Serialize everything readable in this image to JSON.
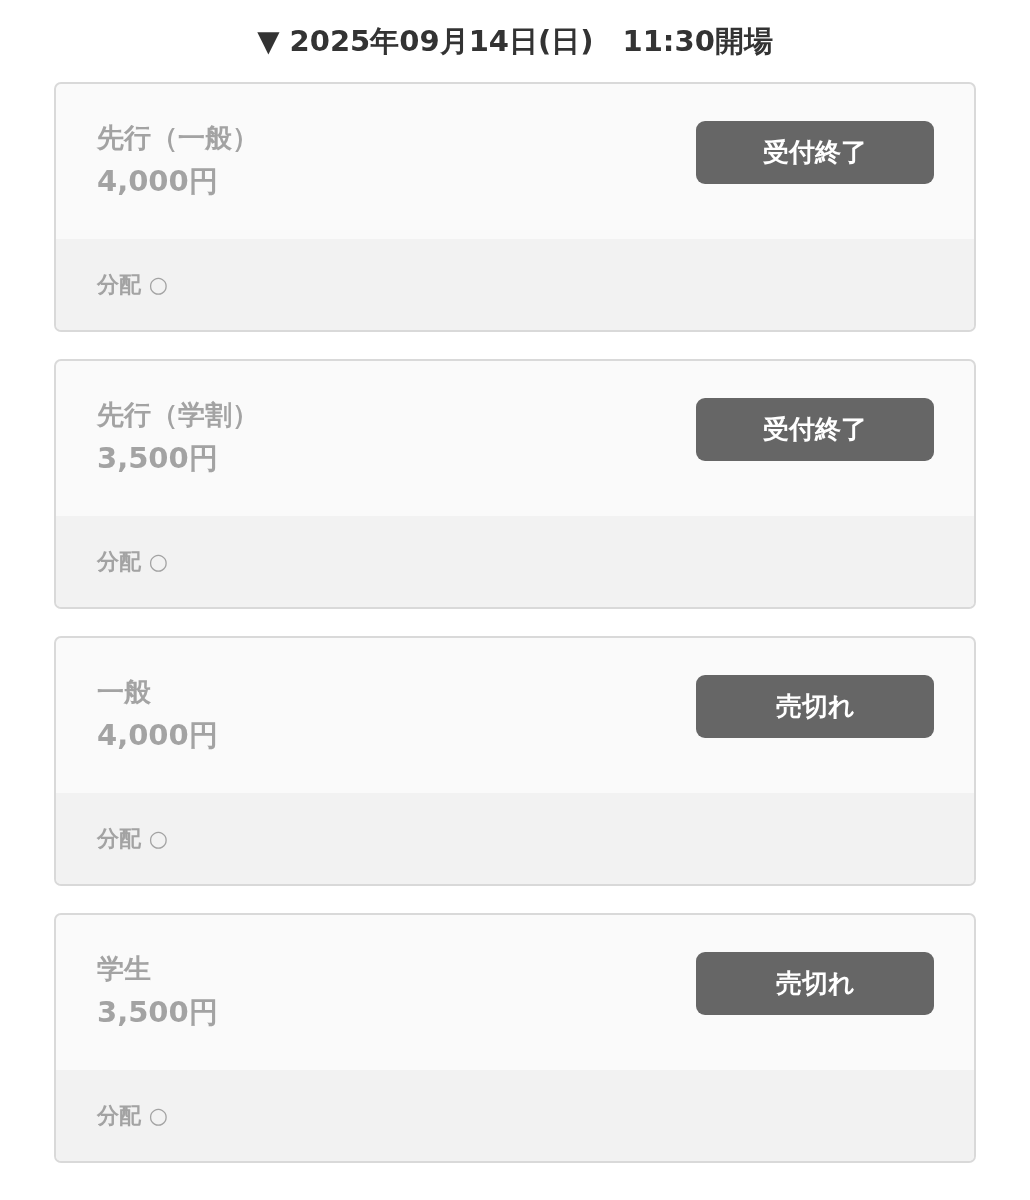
{
  "heading": "▼ 2025年09月14日(日)　11:30開場",
  "tickets": [
    {
      "name": "先行（一般）",
      "price": "4,000円",
      "status": "受付終了",
      "allocation": "分配 ○"
    },
    {
      "name": "先行（学割）",
      "price": "3,500円",
      "status": "受付終了",
      "allocation": "分配 ○"
    },
    {
      "name": "一般",
      "price": "4,000円",
      "status": "売切れ",
      "allocation": "分配 ○"
    },
    {
      "name": "学生",
      "price": "3,500円",
      "status": "売切れ",
      "allocation": "分配 ○"
    }
  ]
}
